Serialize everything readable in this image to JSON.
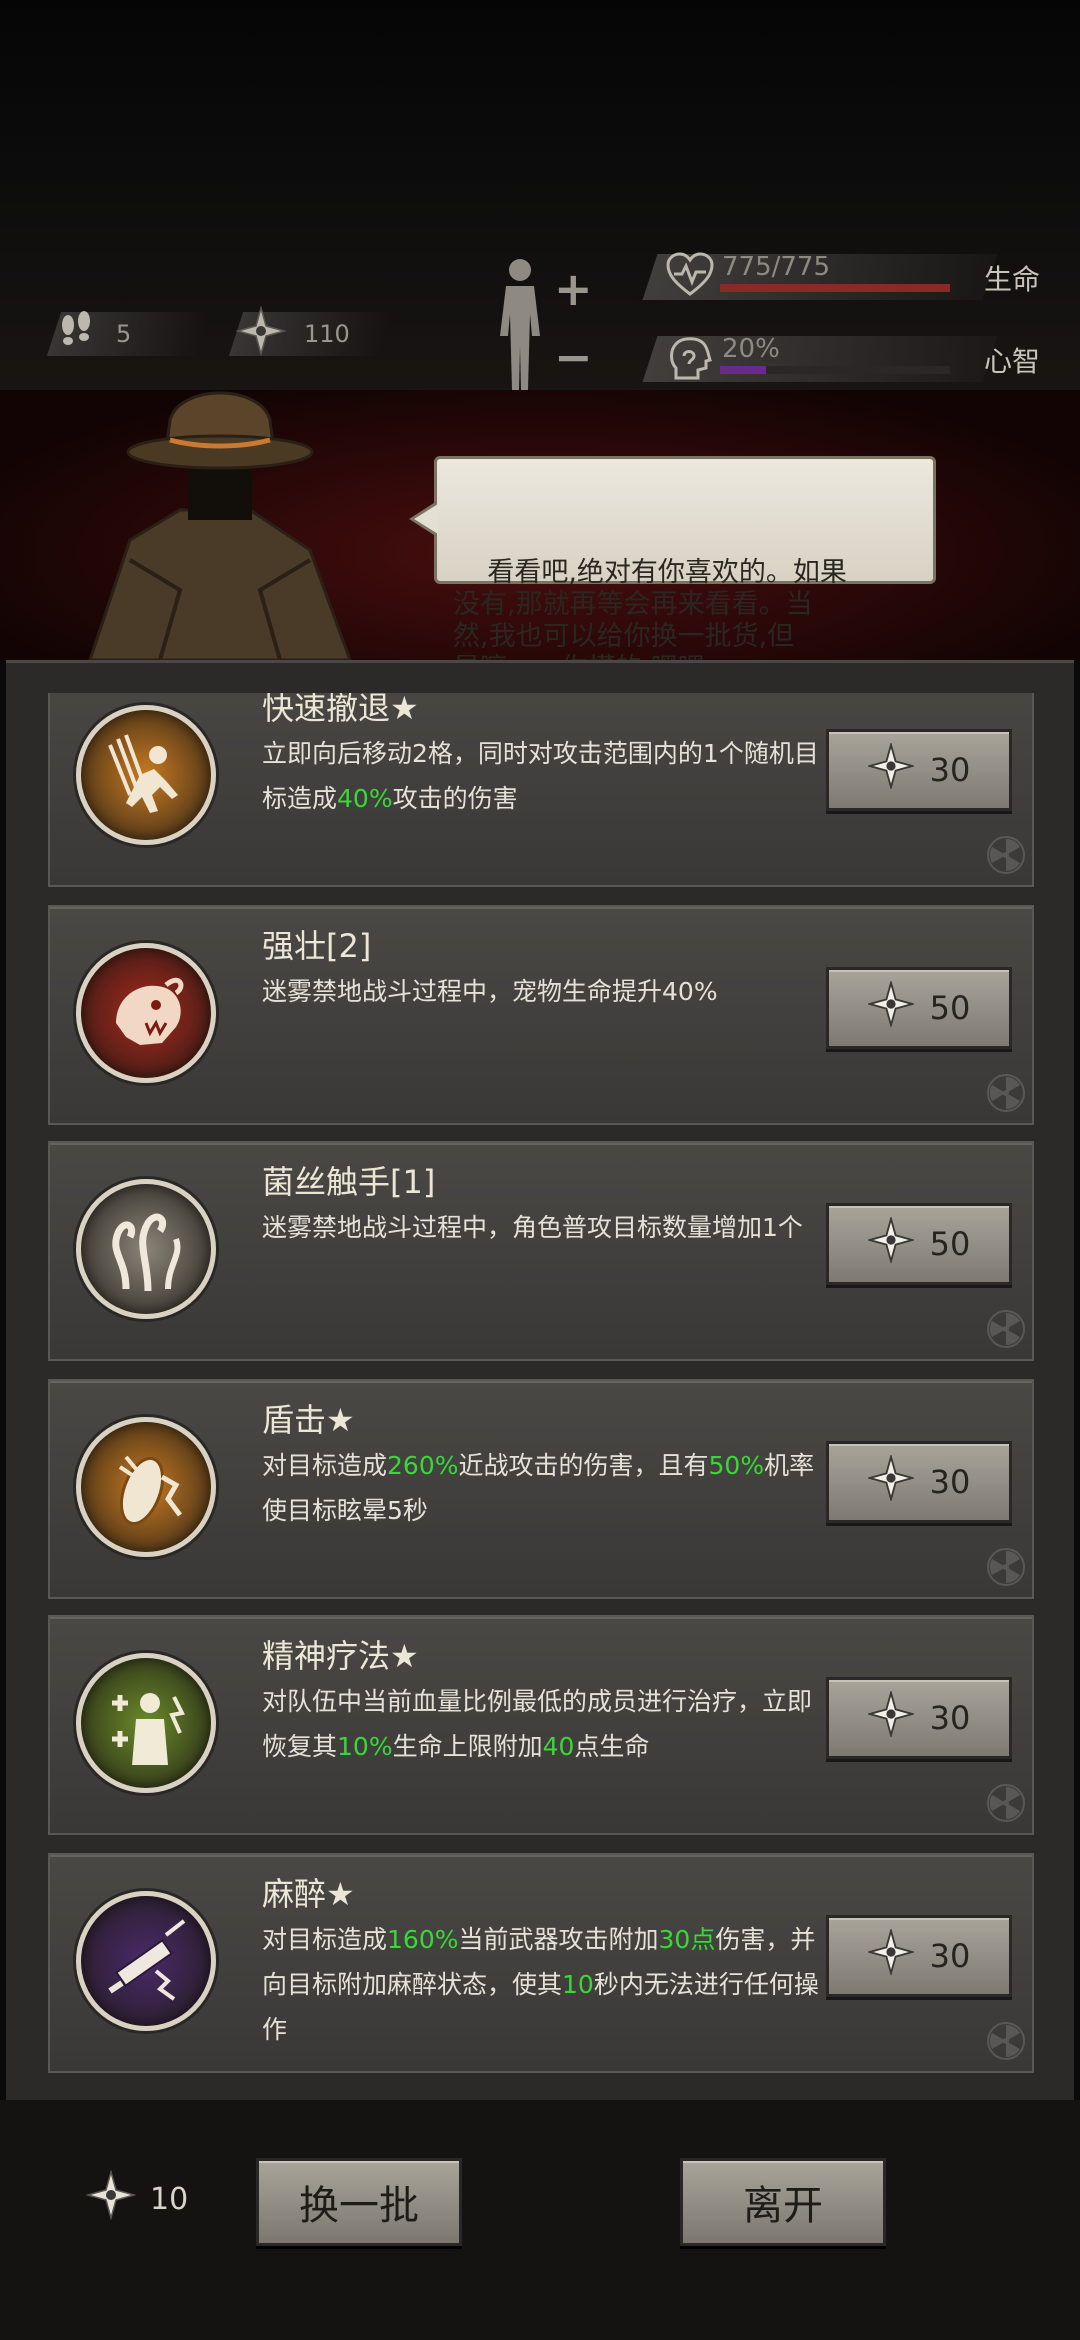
{
  "hud": {
    "steps": "5",
    "currency": "110",
    "health_value": "775/775",
    "health_fraction": 1.0,
    "health_label": "生命",
    "sanity_value": "20%",
    "sanity_fraction": 0.2,
    "sanity_label": "心智",
    "plus_symbol": "+",
    "minus_symbol": "−"
  },
  "merchant": {
    "dialogue": "看看吧,绝对有你喜欢的。如果\n没有,那就再等会再来看看。当\n然,我也可以给你换一批货,但\n是嘛……你懂的,嘿嘿。"
  },
  "colors": {
    "health_bar": "#8a2a26",
    "sanity_bar": "#6a2a8a",
    "highlight": "#38d838"
  },
  "items": [
    {
      "title": "快速撤退★",
      "desc": [
        {
          "t": "立即向后移动2格，同时对攻击范围内的1个随机目标造成"
        },
        {
          "t": "40%",
          "hl": true
        },
        {
          "t": "攻击的伤害"
        }
      ],
      "price": "30",
      "icon": "retreat-icon",
      "icon_color": "#c87a22"
    },
    {
      "title": "强壮[2]",
      "desc": [
        {
          "t": "迷雾禁地战斗过程中，宠物生命提升40%"
        }
      ],
      "price": "50",
      "icon": "beast-icon",
      "icon_color": "#a8281e"
    },
    {
      "title": "菌丝触手[1]",
      "desc": [
        {
          "t": "迷雾禁地战斗过程中，角色普攻目标数量增加1个"
        }
      ],
      "price": "50",
      "icon": "tentacle-icon",
      "icon_color": "#8a8478"
    },
    {
      "title": "盾击★",
      "desc": [
        {
          "t": "对目标造成"
        },
        {
          "t": "260%",
          "hl": true
        },
        {
          "t": "近战攻击的伤害，且有"
        },
        {
          "t": "50%",
          "hl": true
        },
        {
          "t": "机率使目标眩晕5秒"
        }
      ],
      "price": "30",
      "icon": "shield-bash-icon",
      "icon_color": "#c87a22"
    },
    {
      "title": "精神疗法★",
      "desc": [
        {
          "t": "对队伍中当前血量比例最低的成员进行治疗，立即恢复其"
        },
        {
          "t": "10%",
          "hl": true
        },
        {
          "t": "生命上限附加"
        },
        {
          "t": "40",
          "hl": true
        },
        {
          "t": "点生命"
        }
      ],
      "price": "30",
      "icon": "heal-icon",
      "icon_color": "#6a8a2a"
    },
    {
      "title": "麻醉★",
      "desc": [
        {
          "t": "对目标造成"
        },
        {
          "t": "160%",
          "hl": true
        },
        {
          "t": "当前武器攻击附加"
        },
        {
          "t": "30点",
          "hl": true
        },
        {
          "t": "伤害，并向目标附加麻醉状态，使其"
        },
        {
          "t": "10",
          "hl": true
        },
        {
          "t": "秒内无法进行任何操作"
        }
      ],
      "price": "30",
      "icon": "syringe-icon",
      "icon_color": "#4a2a6a"
    }
  ],
  "footer": {
    "currency": "10",
    "refresh_label": "换一批",
    "leave_label": "离开"
  }
}
